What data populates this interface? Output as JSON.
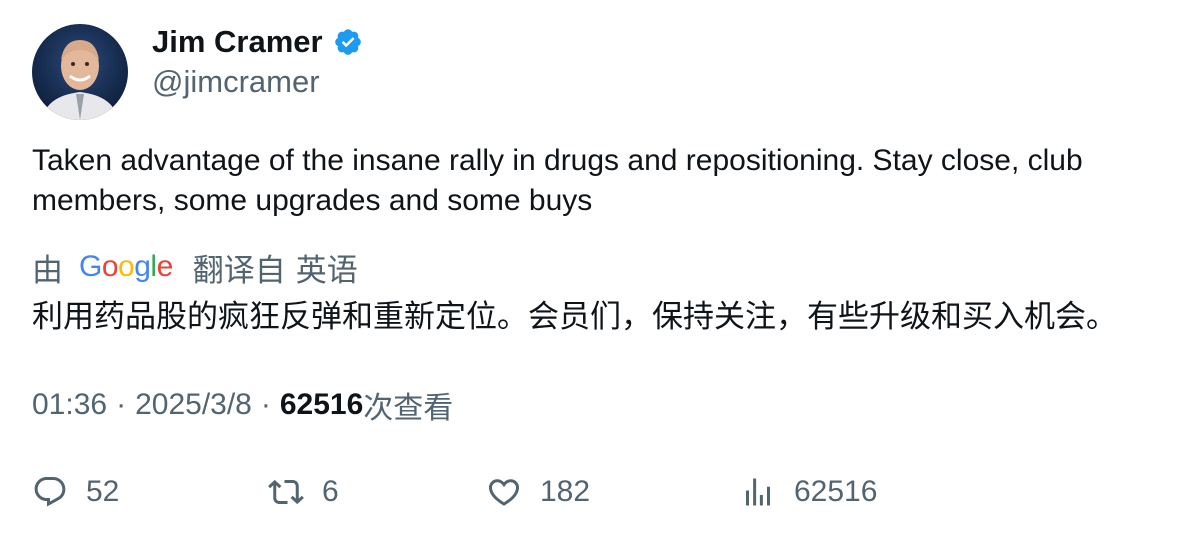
{
  "author": {
    "name": "Jim Cramer",
    "handle": "@jimcramer",
    "verified_icon": "verified-badge-icon",
    "accent_color": "#1d9bf0"
  },
  "tweet": {
    "text": "Taken advantage of the insane rally in drugs and repositioning. Stay close, club members, some upgrades and some buys"
  },
  "translation": {
    "by_label": "由",
    "provider_logo": "Google",
    "translated_from_label": "翻译自",
    "language": "英语",
    "text": "利用药品股的疯狂反弹和重新定位。会员们，保持关注，有些升级和买入机会。"
  },
  "meta": {
    "time": "01:36",
    "separator": "·",
    "date": "2025/3/8",
    "views_count": "62516",
    "views_label": "次查看"
  },
  "actions": {
    "reply": {
      "icon": "reply-icon",
      "count": "52"
    },
    "retweet": {
      "icon": "retweet-icon",
      "count": "6"
    },
    "like": {
      "icon": "heart-icon",
      "count": "182"
    },
    "views": {
      "icon": "analytics-icon",
      "count": "62516"
    }
  }
}
